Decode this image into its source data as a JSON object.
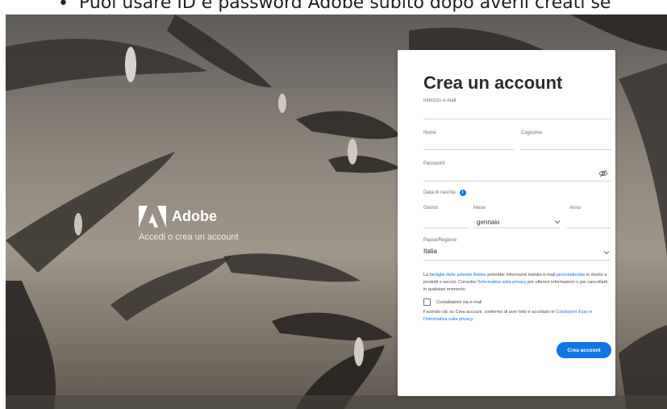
{
  "caption": {
    "bullet": "•",
    "text": "Puoi usare ID e password Adobe subito dopo averli creati se"
  },
  "brand": {
    "name": "Adobe",
    "tagline": "Accedi o crea un account"
  },
  "form": {
    "title": "Crea un account",
    "email_label": "Indirizzo e-mail",
    "email_value": "",
    "first_name_label": "Nome",
    "first_name_value": "",
    "last_name_label": "Cognome",
    "last_name_value": "",
    "password_label": "Password",
    "password_value": "",
    "dob_label": "Data di nascita",
    "day_label": "Giorno",
    "day_value": "",
    "month_label": "Mese",
    "month_value": "gennaio",
    "year_label": "Anno",
    "year_value": "",
    "country_label": "Paese/Regione",
    "country_value": "Italia",
    "legal1_part1": "La ",
    "legal1_link1": "famiglia delle aziende Adobe",
    "legal1_part2": " potrebbe informarmi tramite e-mail ",
    "legal1_link2": "personalizzate",
    "legal1_part3": " in merito a prodotti e servizi. Consulta ",
    "legal1_link3": "l'Informativa sulla privacy",
    "legal1_part4": " per ulteriori informazioni o per cancellarti in qualsiasi momento.",
    "checkbox_label": "Contattatemi via e-mail",
    "checkbox_checked": false,
    "legal2_part1": "Facendo clic su Crea account, confermo di aver letto e accettato le ",
    "legal2_link1": "Condizioni d'uso",
    "legal2_part2": " e ",
    "legal2_link2": "l'Informativa sulla privacy",
    "legal2_part3": ".",
    "submit_label": "Crea account"
  },
  "colors": {
    "accent": "#1473e6",
    "card": "#ffffff",
    "title": "#2c2c2c"
  },
  "icons": {
    "logo": "adobe-logo-icon",
    "info": "info-icon",
    "password_toggle": "eye-slash-icon",
    "select": "chevron-down-icon"
  }
}
